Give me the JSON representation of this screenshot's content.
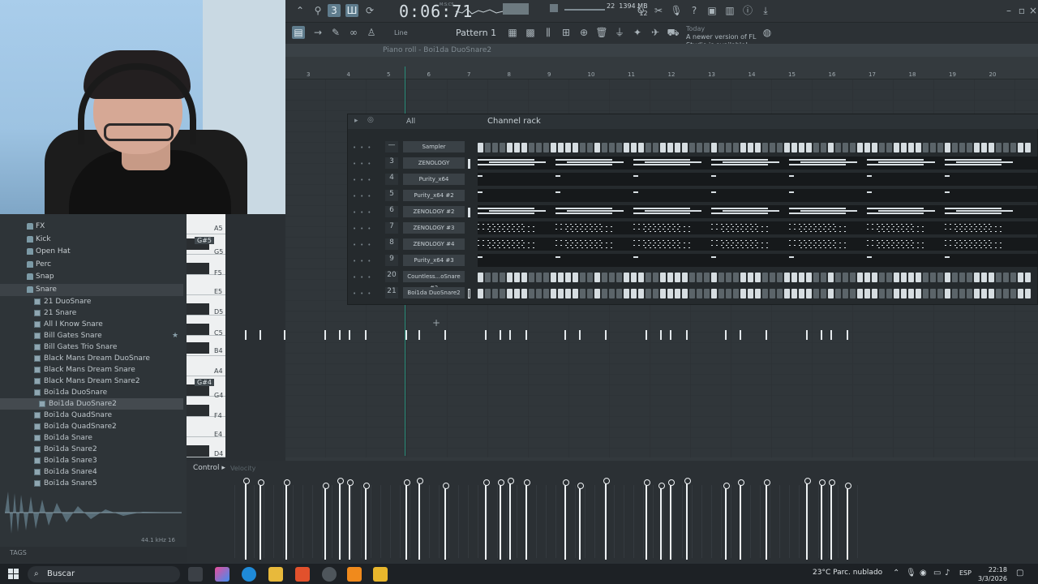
{
  "toolbar": {
    "time_display": "0:06:71",
    "time_unit": "M:S:CS",
    "memory": "1394 MB",
    "cpu": "22",
    "voices": "12",
    "snap_mode": "Line",
    "pattern": "Pattern 1",
    "news_day": "Today",
    "news_text": "A newer version of FL Studio is available!"
  },
  "piano_roll": {
    "title": "Piano roll - Boi1da DuoSnare2",
    "ruler_numbers": [
      "3",
      "4",
      "5",
      "6",
      "7",
      "8",
      "9",
      "10",
      "11",
      "12",
      "13",
      "14",
      "15",
      "16",
      "17",
      "18",
      "19",
      "20"
    ],
    "key_labels": {
      "A5": "A5",
      "Gs5": "G#5",
      "G5": "G5",
      "F5": "F5",
      "E5": "E5",
      "D5": "D5",
      "C5": "C5",
      "B4": "B4",
      "A4": "A4",
      "Gs4": "G#4",
      "G4": "G4",
      "F4": "F4",
      "E4": "E4",
      "D4": "D4"
    },
    "control_label": "Control",
    "control_param": "Velocity"
  },
  "channel_rack": {
    "title": "Channel rack",
    "filter": "All",
    "channels": [
      {
        "num": "—",
        "name": "Sampler"
      },
      {
        "num": "3",
        "name": "ZENOLOGY"
      },
      {
        "num": "4",
        "name": "Purity_x64"
      },
      {
        "num": "5",
        "name": "Purity_x64 #2"
      },
      {
        "num": "6",
        "name": "ZENOLOGY #2"
      },
      {
        "num": "7",
        "name": "ZENOLOGY #3"
      },
      {
        "num": "8",
        "name": "ZENOLOGY #4"
      },
      {
        "num": "9",
        "name": "Purity_x64 #3"
      },
      {
        "num": "20",
        "name": "Countless...oSnare #2"
      },
      {
        "num": "21",
        "name": "Boi1da DuoSnare2"
      }
    ]
  },
  "browser": {
    "folders": [
      "FX",
      "Kick",
      "Open Hat",
      "Perc",
      "Snap",
      "Snare"
    ],
    "files": [
      "21 DuoSnare",
      "21 Snare",
      "All I Know Snare",
      "Bill Gates Snare",
      "Bill Gates Trio Snare",
      "Black Mans Dream DuoSnare",
      "Black Mans Dream Snare",
      "Black Mans Dream Snare2",
      "Boi1da DuoSnare",
      "Boi1da DuoSnare2",
      "Boi1da QuadSnare",
      "Boi1da QuadSnare2",
      "Boi1da Snare",
      "Boi1da Snare2",
      "Boi1da Snare3",
      "Boi1da Snare4",
      "Boi1da Snare5"
    ],
    "selected": "Boi1da DuoSnare2",
    "sample_rate": "44.1 kHz 16",
    "tags_label": "TAGS"
  },
  "taskbar": {
    "search_placeholder": "Buscar",
    "weather": "23°C  Parc. nublado",
    "language": "ESP",
    "time": "22:18",
    "date": "3/3/2026"
  }
}
